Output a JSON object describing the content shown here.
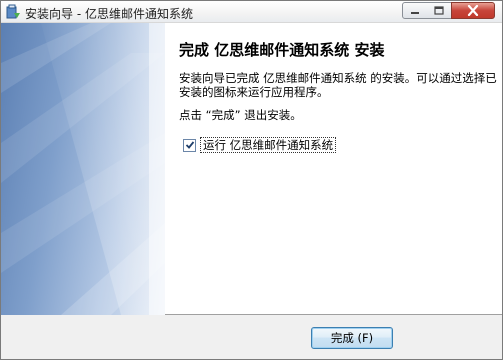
{
  "window": {
    "title": "安装向导 - 亿思维邮件通知系统",
    "controls": [
      "minimize-icon",
      "maximize-icon",
      "close-icon"
    ],
    "accent_close": "#c7453a"
  },
  "main": {
    "heading": "完成 亿思维邮件通知系统 安装",
    "paragraph1": "安装向导已完成 亿思维邮件通知系统 的安装。可以通过选择已安装的图标来运行应用程序。",
    "paragraph2": "点击 “完成” 退出安装。",
    "run_checkbox": {
      "label": "运行 亿思维邮件通知系统",
      "checked": true
    }
  },
  "footer": {
    "finish_label": "完成 (F)"
  }
}
